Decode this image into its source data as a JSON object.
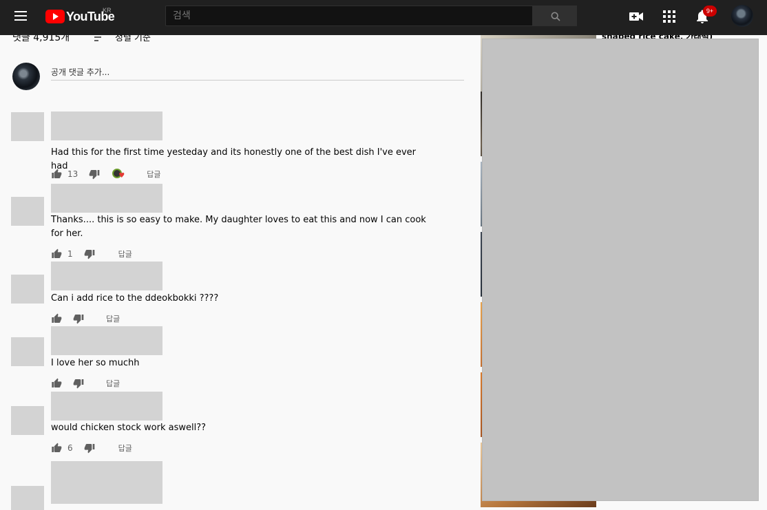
{
  "header": {
    "logo_text": "YouTube",
    "region": "KR",
    "search_placeholder": "검색",
    "notification_badge": "9+"
  },
  "comments": {
    "count_label": "댓글 4,915개",
    "sort_label": "정렬 기준",
    "add_placeholder": "공개 댓글 추가...",
    "reply_label": "답글",
    "items": [
      {
        "text": "Had this for the first time yesteday and its honestly one of the best dish I've ever had",
        "likes": "13",
        "hearted": true
      },
      {
        "text": "Thanks.... this is so easy to make. My daughter loves to eat this and now I can cook for her.",
        "likes": "1",
        "hearted": false
      },
      {
        "text": "Can i add rice to the ddeokbokki ????",
        "likes": "",
        "hearted": false
      },
      {
        "text": "I love her so muchh",
        "likes": "",
        "hearted": false
      },
      {
        "text": "would chicken stock work aswell??",
        "likes": "6",
        "hearted": false
      }
    ]
  },
  "sidebar": {
    "partial_title": "shaped rice cake, 가래떡)"
  },
  "colors": {
    "header_bg": "#202020",
    "brand_red": "#ff0000",
    "placeholder_gray": "#d3d3d3",
    "overlay_gray": "#c2c2c2"
  }
}
